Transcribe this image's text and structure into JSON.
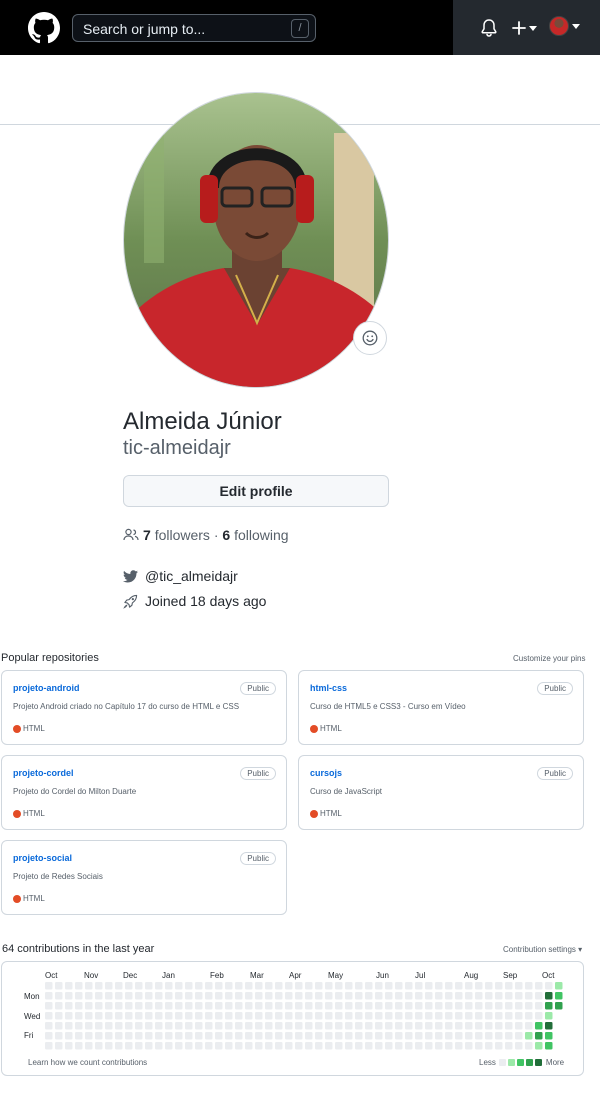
{
  "header": {
    "search_placeholder": "Search or jump to...",
    "search_shortcut": "/",
    "icons": [
      "github-logo-icon",
      "bell-icon",
      "plus-icon",
      "avatar"
    ]
  },
  "profile": {
    "name": "Almeida Júnior",
    "login": "tic-almeidajr",
    "edit_label": "Edit profile",
    "followers_count": "7",
    "followers_label": "followers",
    "dot": "·",
    "following_count": "6",
    "following_label": "following",
    "twitter": "@tic_almeidajr",
    "joined": "Joined 18 days ago"
  },
  "repos": {
    "title": "Popular repositories",
    "customize": "Customize your pins",
    "items": [
      {
        "name": "projeto-android",
        "badge": "Public",
        "desc": "Projeto Android criado no Capítulo 17 do curso de HTML e CSS",
        "lang": "HTML"
      },
      {
        "name": "html-css",
        "badge": "Public",
        "desc": "Curso de HTML5 e CSS3 - Curso em Vídeo",
        "lang": "HTML"
      },
      {
        "name": "projeto-cordel",
        "badge": "Public",
        "desc": "Projeto do Cordel do Milton Duarte",
        "lang": "HTML"
      },
      {
        "name": "cursojs",
        "badge": "Public",
        "desc": "Curso de JavaScript",
        "lang": "HTML"
      },
      {
        "name": "projeto-social",
        "badge": "Public",
        "desc": "Projeto de Redes Sociais",
        "lang": "HTML"
      }
    ],
    "lang_color": "#e34c26"
  },
  "contributions": {
    "title": "64 contributions in the last year",
    "settings": "Contribution settings ▾",
    "months": [
      "Oct",
      "Nov",
      "Dec",
      "Jan",
      "Feb",
      "Mar",
      "Apr",
      "May",
      "Jun",
      "Jul",
      "Aug",
      "Sep",
      "Oct"
    ],
    "weekdays": [
      "Mon",
      "Wed",
      "Fri"
    ],
    "learn": "Learn how we count contributions",
    "less": "Less",
    "more": "More",
    "colors": [
      "#ebedf0",
      "#9be9a8",
      "#40c463",
      "#30a14e",
      "#216e39"
    ],
    "active_cells": [
      {
        "week": 48,
        "day": 5,
        "level": 1
      },
      {
        "week": 49,
        "day": 4,
        "level": 2
      },
      {
        "week": 49,
        "day": 5,
        "level": 3
      },
      {
        "week": 49,
        "day": 6,
        "level": 1
      },
      {
        "week": 50,
        "day": 1,
        "level": 4
      },
      {
        "week": 50,
        "day": 2,
        "level": 3
      },
      {
        "week": 50,
        "day": 3,
        "level": 1
      },
      {
        "week": 50,
        "day": 4,
        "level": 4
      },
      {
        "week": 50,
        "day": 5,
        "level": 2
      },
      {
        "week": 50,
        "day": 6,
        "level": 2
      },
      {
        "week": 51,
        "day": 0,
        "level": 1
      },
      {
        "week": 51,
        "day": 1,
        "level": 2
      },
      {
        "week": 51,
        "day": 2,
        "level": 3
      }
    ]
  }
}
